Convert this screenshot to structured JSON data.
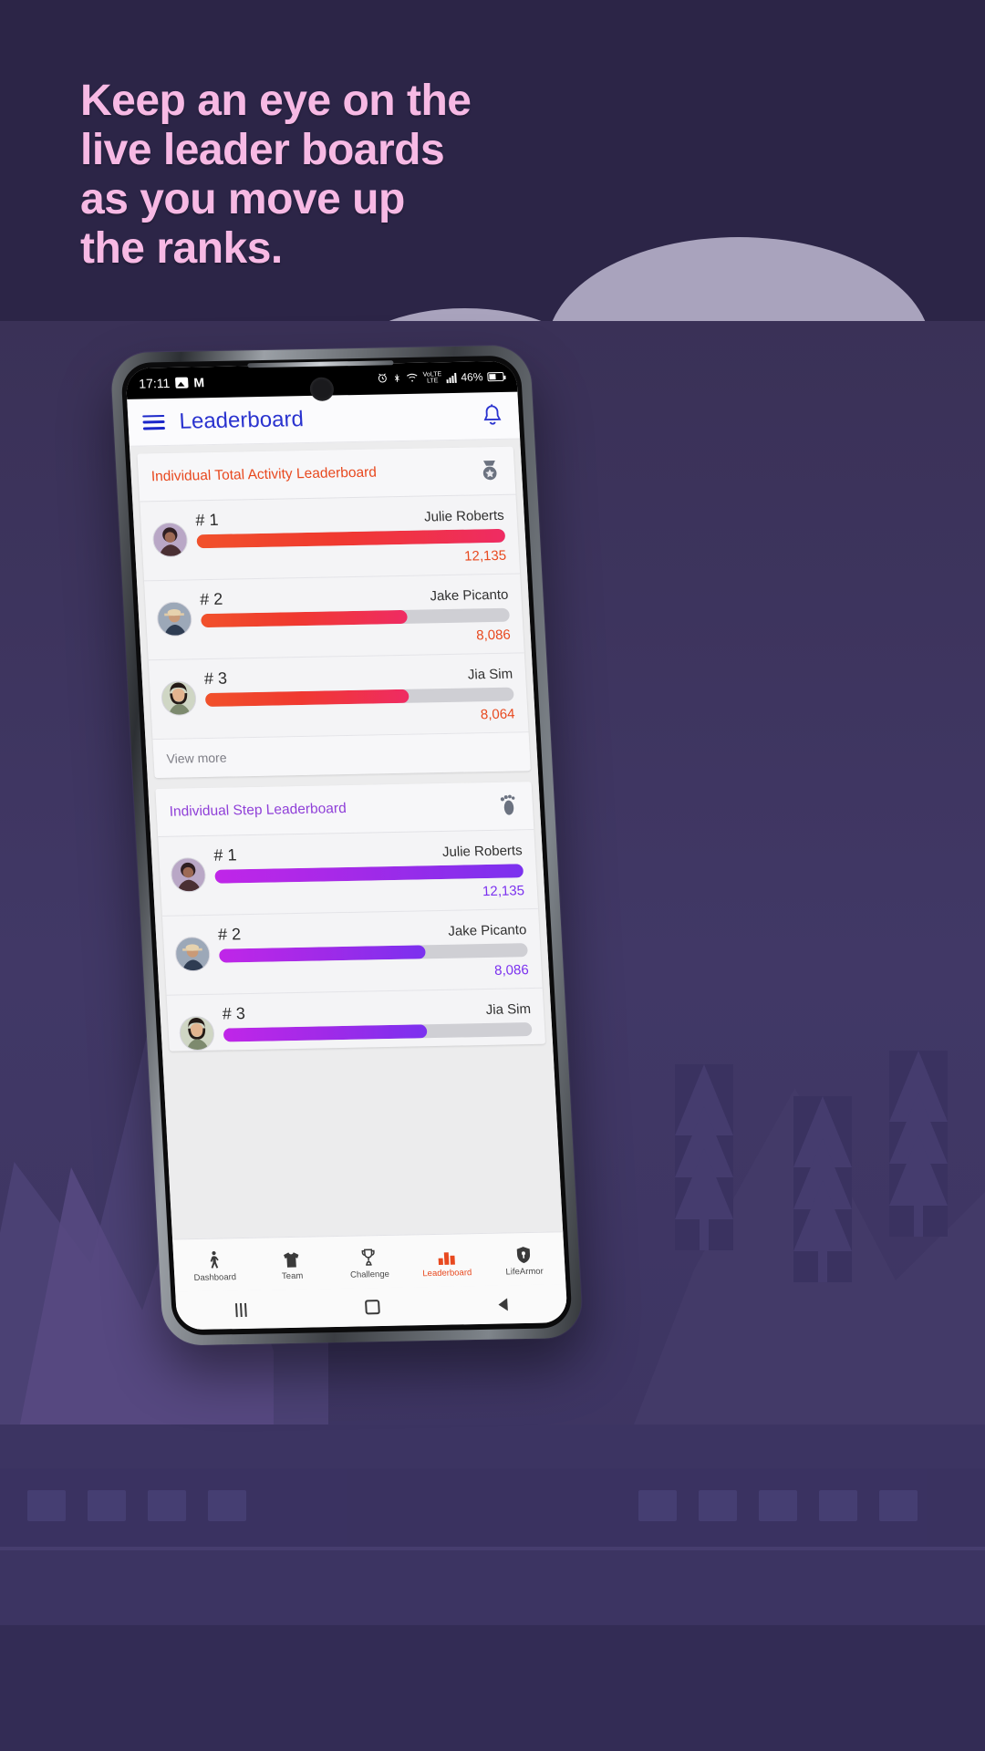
{
  "marketing": {
    "headline_lines": [
      "Keep an eye on the",
      "live leader boards",
      "as you move up",
      "the ranks."
    ],
    "headline_color": "#f7b9e4",
    "background_color": "#2c2547"
  },
  "phone": {
    "status_bar": {
      "time": "17:11",
      "icons_left": [
        "photos-icon",
        "gmail-icon"
      ],
      "icons_right": [
        "alarm-icon",
        "bluetooth-icon",
        "wifi-icon",
        "volte-icon",
        "signal-icon"
      ],
      "volte_label_top": "VoLTE",
      "volte_label_bottom": "LTE",
      "battery_percent": "46%"
    },
    "header": {
      "menu_icon": "hamburger-icon",
      "title": "Leaderboard",
      "title_color": "#2a33cf",
      "notification_icon": "bell-icon"
    },
    "cards": [
      {
        "id": "individual-total-activity",
        "title": "Individual Total Activity Leaderboard",
        "title_color": "#e8491f",
        "icon": "medal-icon",
        "bar_gradient": [
          "#f1512b",
          "#ef2b63"
        ],
        "rows": [
          {
            "rank": "# 1",
            "name": "Julie Roberts",
            "score": "12,135",
            "percent": 100
          },
          {
            "rank": "# 2",
            "name": "Jake Picanto",
            "score": "8,086",
            "percent": 67
          },
          {
            "rank": "# 3",
            "name": "Jia Sim",
            "score": "8,064",
            "percent": 66
          }
        ],
        "footer_label": "View more"
      },
      {
        "id": "individual-step",
        "title": "Individual Step Leaderboard",
        "title_color": "#8f3fd8",
        "icon": "footprint-icon",
        "bar_gradient": [
          "#c026e8",
          "#7b31ef"
        ],
        "rows": [
          {
            "rank": "# 1",
            "name": "Julie Roberts",
            "score": "12,135",
            "percent": 100
          },
          {
            "rank": "# 2",
            "name": "Jake Picanto",
            "score": "8,086",
            "percent": 67
          },
          {
            "rank": "# 3",
            "name": "Jia Sim",
            "score": "",
            "percent": 66
          }
        ],
        "footer_label": ""
      }
    ],
    "bottom_nav": [
      {
        "label": "Dashboard",
        "icon": "walking-person-icon",
        "active": false
      },
      {
        "label": "Team",
        "icon": "tshirt-icon",
        "active": false
      },
      {
        "label": "Challenge",
        "icon": "trophy-icon",
        "active": false
      },
      {
        "label": "Leaderboard",
        "icon": "bar-chart-icon",
        "active": true
      },
      {
        "label": "LifeArmor",
        "icon": "shield-icon",
        "active": false
      }
    ],
    "system_nav": {
      "recents": "recents-icon",
      "home": "home-icon",
      "back": "back-icon"
    }
  }
}
